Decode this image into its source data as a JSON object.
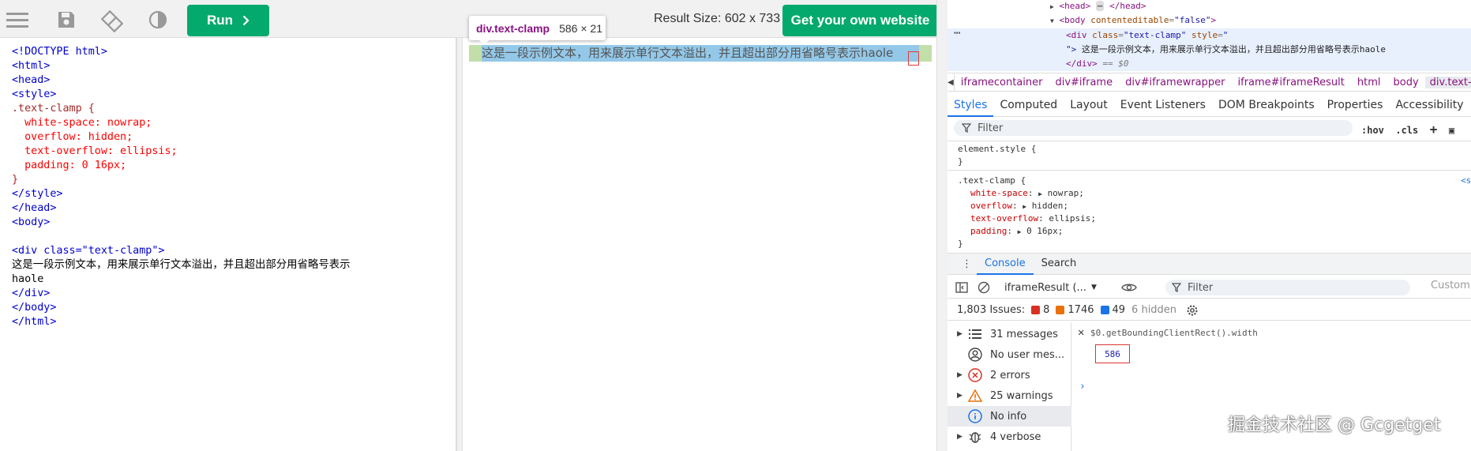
{
  "toolbar": {
    "run_label": "Run",
    "result_size": "Result Size: 602 x 733",
    "get_website_label": "Get your own website"
  },
  "editor": {
    "lines": [
      "<!DOCTYPE html>",
      "<html>",
      "<head>",
      "<style>",
      ".text-clamp {",
      "  white-space: nowrap;",
      "  overflow: hidden;",
      "  text-overflow: ellipsis;",
      "  padding: 0 16px;",
      "}",
      "</style>",
      "</head>",
      "<body>",
      "",
      "<div class=\"text-clamp\">",
      "这是一段示例文本，用来展示单行文本溢出，并且超出部分用省略号表示",
      "haole",
      "</div>",
      "</body>",
      "</html>"
    ]
  },
  "result": {
    "text": "这是一段示例文本，用来展示单行文本溢出，并且超出部分用省略号表示haole"
  },
  "tooltip": {
    "name": "div.text-clamp",
    "size": "586 × 21"
  },
  "devtools": {
    "dom": {
      "head": "<head>",
      "head_ellipsis": "⋯",
      "head_close": "</head>",
      "body_open_tag": "<body ",
      "body_attr": "contenteditable",
      "body_val": "\"false\"",
      "body_close_bracket": ">",
      "div_open": "<div ",
      "div_attr1": "class",
      "div_val1": "\"text-clamp\"",
      "div_attr2": " style",
      "div_val2": "\"",
      "div_text_pre": "\"> ",
      "div_text": "这是一段示例文本，用来展示单行文本溢出，并且超出部分用省略号表示haole",
      "div_close": "</div>",
      "div_eq": " == $0"
    },
    "crumbs": [
      "iframecontainer",
      "div#iframe",
      "div#iframewrapper",
      "iframe#iframeResult",
      "html",
      "body",
      "div.text-cla"
    ],
    "sub_tabs": [
      "Styles",
      "Computed",
      "Layout",
      "Event Listeners",
      "DOM Breakpoints",
      "Properties",
      "Accessibility"
    ],
    "filter_placeholder": "Filter",
    "hov": ":hov",
    "cls": ".cls",
    "styles": {
      "element_style": "element.style {",
      "close": "}",
      "rule_selector": ".text-clamp {",
      "rule_link": "<s",
      "props": [
        {
          "name": "white-space",
          "value": "nowrap;"
        },
        {
          "name": "overflow",
          "value": "hidden;"
        },
        {
          "name": "text-overflow",
          "value": "ellipsis;"
        },
        {
          "name": "padding",
          "value": "0 16px;"
        }
      ]
    },
    "console_tabs": [
      "Console",
      "Search"
    ],
    "context": "iframeResult (...",
    "console_filter": "Filter",
    "custom_levels": "Custom le",
    "issues": {
      "label": "1,803 Issues:",
      "errors": "8",
      "warnings": "1746",
      "info": "49",
      "hidden": "6 hidden"
    },
    "messages": [
      {
        "label": "31 messages",
        "icon": "list-icon"
      },
      {
        "label": "No user mes...",
        "icon": "user-icon"
      },
      {
        "label": "2 errors",
        "icon": "error-icon"
      },
      {
        "label": "25 warnings",
        "icon": "warning-icon"
      },
      {
        "label": "No info",
        "icon": "info-icon"
      },
      {
        "label": "4 verbose",
        "icon": "bug-icon"
      }
    ],
    "console_expr": "$0.getBoundingClientRect().width",
    "console_result": "586"
  },
  "watermark": "掘金技术社区 @ Gcgetget",
  "colors": {
    "accent": "#04aa6d",
    "devtools_blue": "#1a73e8",
    "highlight_content": "#93c8e8",
    "highlight_padding": "#c3dfa9"
  }
}
